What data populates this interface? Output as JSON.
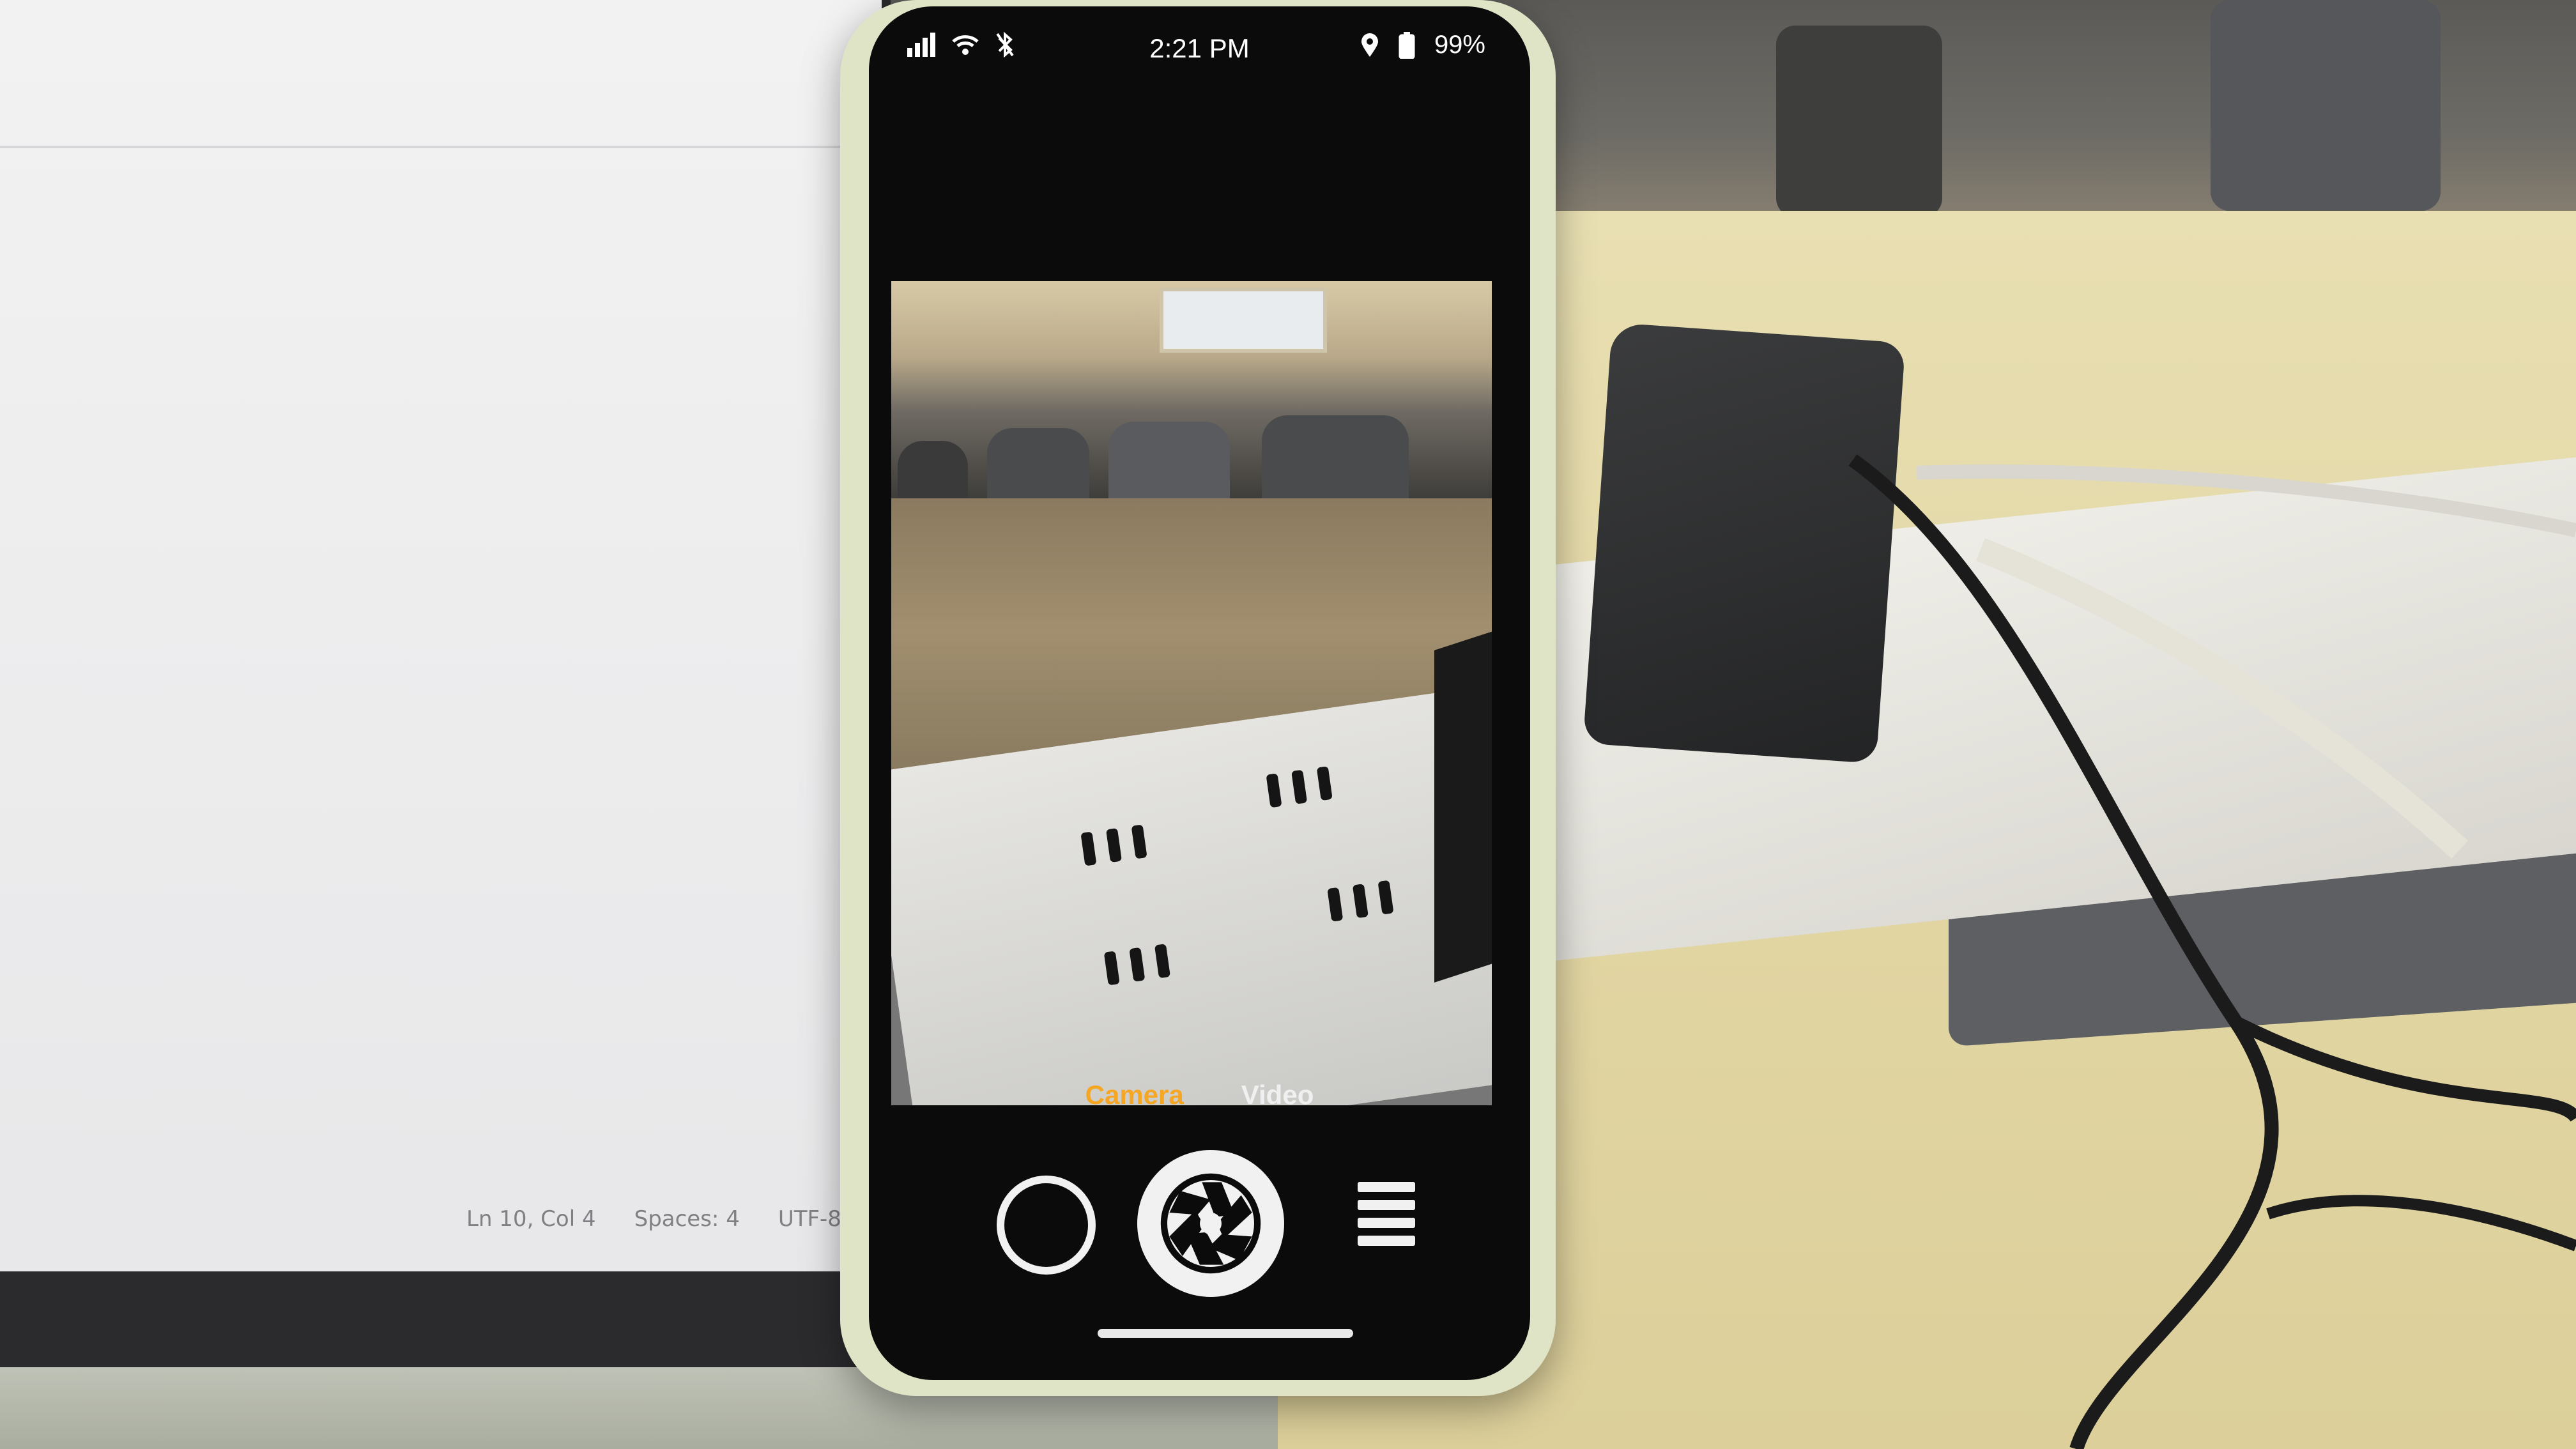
{
  "monitor_statusbar": {
    "position": "Ln 10, Col 4",
    "indent": "Spaces: 4",
    "encoding": "UTF-8"
  },
  "phone": {
    "status_bar": {
      "time": "2:21 PM",
      "battery": "99%",
      "icons": [
        "signal-icon",
        "wifi-icon",
        "bluetooth-off-icon",
        "location-icon",
        "battery-icon"
      ]
    },
    "camera_app": {
      "modes": [
        {
          "label": "Camera",
          "active": true
        },
        {
          "label": "Video",
          "active": false
        }
      ],
      "controls": [
        "gallery-button",
        "shutter-button",
        "menu-button"
      ],
      "accent_color": "#f5a623"
    }
  }
}
